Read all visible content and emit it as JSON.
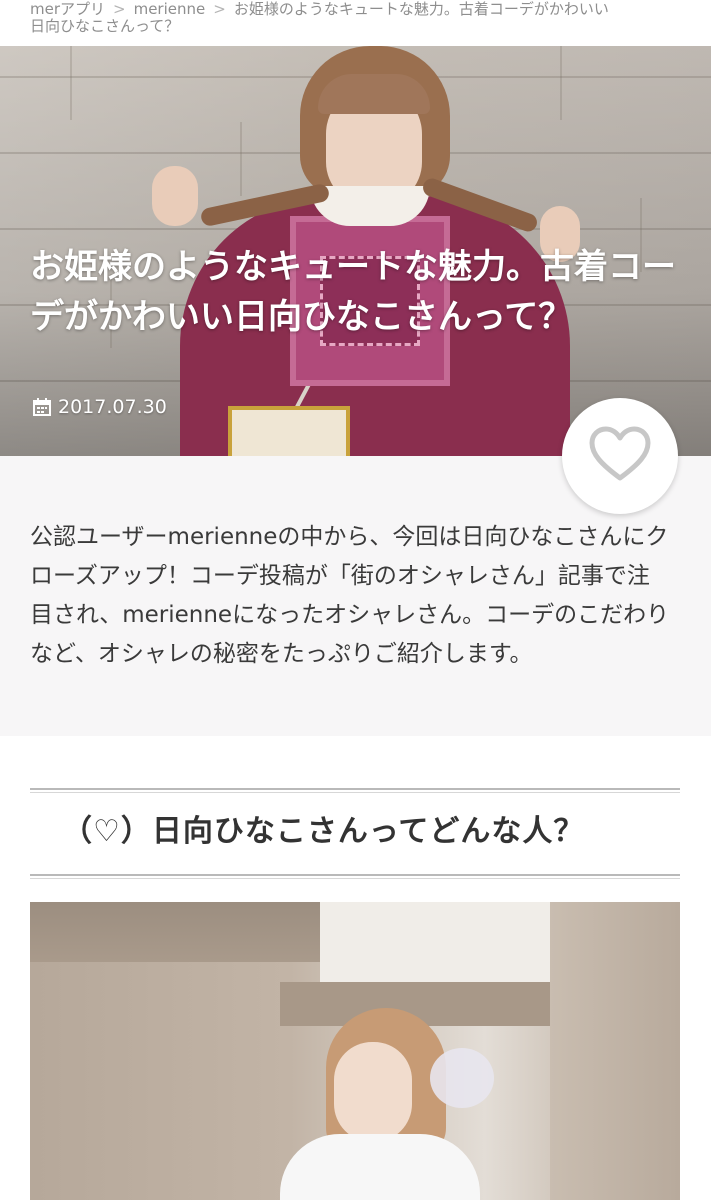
{
  "breadcrumb": {
    "items": [
      "merアプリ",
      "merienne"
    ],
    "current_line1": "お姫様のようなキュートな魅力。古着コーデがかわいい",
    "current_line2": "日向ひなこさんって？",
    "separator": ">"
  },
  "article": {
    "title": "お姫様のようなキュートな魅力。古着コーデがかわいい日向ひなこさんって？",
    "date": "2017.07.30",
    "lead": "公認ユーザーmerienneの中から、今回は日向ひなこさんにクローズアップ！コーデ投稿が「街のオシャレさん」記事で注目され、merienneになったオシャレさん。コーデのこだわりなど、オシャレの秘密をたっぷりご紹介します。"
  },
  "section": {
    "heading": "（♡）日向ひなこさんってどんな人？"
  },
  "icons": {
    "date": "calendar-icon",
    "favorite": "heart-icon"
  },
  "colors": {
    "accent_heart": "#c7c7c7",
    "lead_bg": "#f7f6f7",
    "dress": "#8a2e4e"
  }
}
